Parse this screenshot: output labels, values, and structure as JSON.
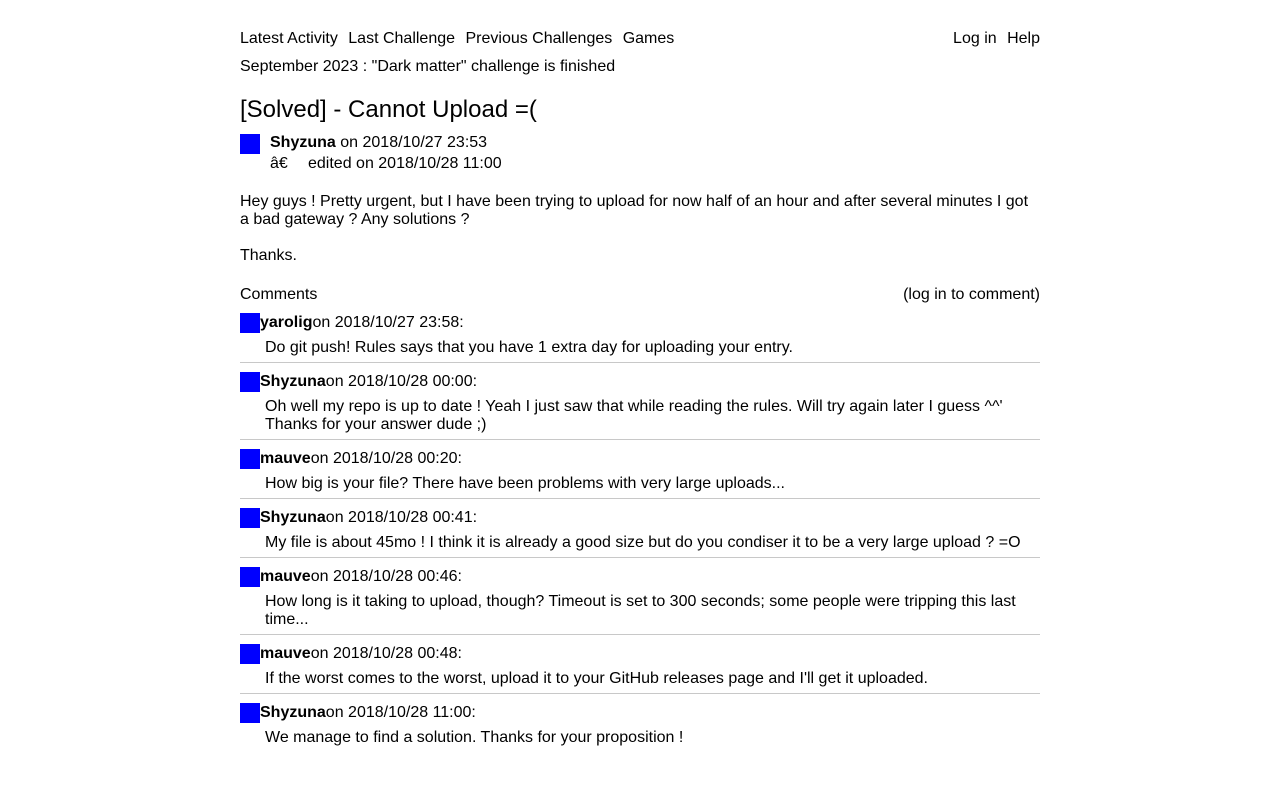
{
  "nav": {
    "left": [
      "Latest Activity",
      "Last Challenge",
      "Previous Challenges",
      "Games"
    ],
    "right": [
      "Log in",
      "Help"
    ]
  },
  "news": "September 2023 : \"Dark matter\" challenge is finished",
  "post": {
    "title": "[Solved] - Cannot Upload =(",
    "author": "Shyzuna",
    "posted": "on 2018/10/27 23:53",
    "edited_glyph": "â€",
    "edited": "edited on 2018/10/28 11:00",
    "paragraphs": [
      "Hey guys ! Pretty urgent, but I have been trying to upload for now half of an hour and after several minutes I got a bad gateway ? Any solutions ?",
      "Thanks."
    ]
  },
  "comments_header": {
    "label": "Comments",
    "login_hint": "(log in to comment)"
  },
  "comments": [
    {
      "author": "yarolig",
      "meta": "on 2018/10/27 23:58:",
      "text": "Do git push! Rules says that you have 1 extra day for uploading your entry."
    },
    {
      "author": "Shyzuna",
      "meta": "on 2018/10/28 00:00:",
      "text": "Oh well my repo is up to date ! Yeah I just saw that while reading the rules. Will try again later I guess ^^' Thanks for your answer dude ;)"
    },
    {
      "author": "mauve",
      "meta": "on 2018/10/28 00:20:",
      "text": "How big is your file? There have been problems with very large uploads..."
    },
    {
      "author": "Shyzuna",
      "meta": "on 2018/10/28 00:41:",
      "text": "My file is about 45mo ! I think it is already a good size but do you condiser it to be a very large upload ? =O"
    },
    {
      "author": "mauve",
      "meta": "on 2018/10/28 00:46:",
      "text": "How long is it taking to upload, though? Timeout is set to 300 seconds; some people were tripping this last time..."
    },
    {
      "author": "mauve",
      "meta": "on 2018/10/28 00:48:",
      "text": "If the worst comes to the worst, upload it to your GitHub releases page and I'll get it uploaded."
    },
    {
      "author": "Shyzuna",
      "meta": "on 2018/10/28 11:00:",
      "text": "We manage to find a solution. Thanks for your proposition !"
    }
  ],
  "colors": {
    "avatar": "#0000ff",
    "divider": "#c8c8c8"
  }
}
